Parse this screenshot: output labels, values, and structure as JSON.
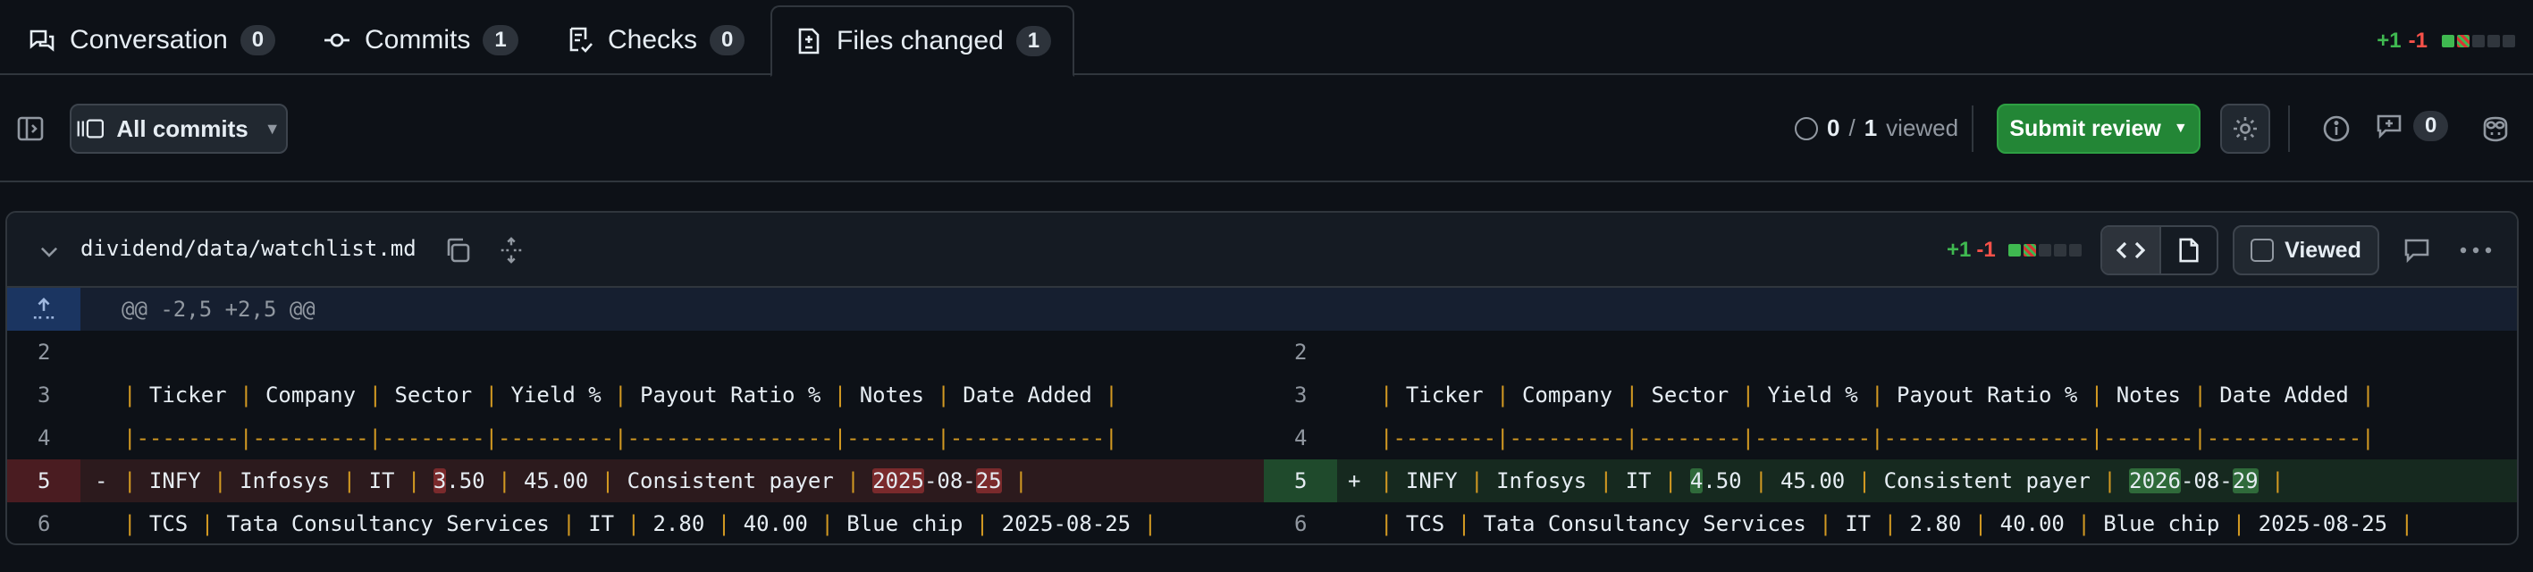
{
  "tabs": [
    {
      "label": "Conversation",
      "count": "0",
      "icon": "conversation-icon"
    },
    {
      "label": "Commits",
      "count": "1",
      "icon": "commit-icon"
    },
    {
      "label": "Checks",
      "count": "0",
      "icon": "checklist-icon"
    },
    {
      "label": "Files changed",
      "count": "1",
      "icon": "file-diff-icon"
    }
  ],
  "diffstat": {
    "additions": "+1",
    "deletions": "-1"
  },
  "toolbar": {
    "commits_label": "All commits",
    "viewed_count": "0",
    "viewed_sep": "/",
    "viewed_total": "1",
    "viewed_label": "viewed",
    "submit_label": "Submit review",
    "comments_count": "0"
  },
  "file": {
    "path": "dividend/data/watchlist.md",
    "additions": "+1",
    "deletions": "-1",
    "viewed_label": "Viewed",
    "hunk_header": "@@ -2,5 +2,5 @@"
  },
  "diff": {
    "left": [
      {
        "line": "2",
        "type": "ctx",
        "sign": "",
        "segments": []
      },
      {
        "line": "3",
        "type": "ctx",
        "sign": "",
        "segments": [
          {
            "t": "| ",
            "c": "pipe"
          },
          {
            "t": "Ticker "
          },
          {
            "t": "| ",
            "c": "pipe"
          },
          {
            "t": "Company "
          },
          {
            "t": "| ",
            "c": "pipe"
          },
          {
            "t": "Sector "
          },
          {
            "t": "| ",
            "c": "pipe"
          },
          {
            "t": "Yield % "
          },
          {
            "t": "| ",
            "c": "pipe"
          },
          {
            "t": "Payout Ratio % "
          },
          {
            "t": "| ",
            "c": "pipe"
          },
          {
            "t": "Notes "
          },
          {
            "t": "| ",
            "c": "pipe"
          },
          {
            "t": "Date Added "
          },
          {
            "t": "|",
            "c": "pipe"
          }
        ]
      },
      {
        "line": "4",
        "type": "ctx",
        "sign": "",
        "segments": [
          {
            "t": "|--------|---------|--------|---------|----------------|-------|------------|",
            "c": "pipe"
          }
        ]
      },
      {
        "line": "5",
        "type": "del",
        "sign": "-",
        "segments": [
          {
            "t": "| ",
            "c": "pipe"
          },
          {
            "t": "INFY "
          },
          {
            "t": "| ",
            "c": "pipe"
          },
          {
            "t": "Infosys "
          },
          {
            "t": "| ",
            "c": "pipe"
          },
          {
            "t": "IT "
          },
          {
            "t": "| ",
            "c": "pipe"
          },
          {
            "t": "3",
            "c": "hl-del"
          },
          {
            "t": ".50 "
          },
          {
            "t": "| ",
            "c": "pipe"
          },
          {
            "t": "45.00 "
          },
          {
            "t": "| ",
            "c": "pipe"
          },
          {
            "t": "Consistent payer "
          },
          {
            "t": "| ",
            "c": "pipe"
          },
          {
            "t": "2025",
            "c": "hl-del"
          },
          {
            "t": "-08-"
          },
          {
            "t": "25",
            "c": "hl-del"
          },
          {
            "t": " "
          },
          {
            "t": "|",
            "c": "pipe"
          }
        ]
      },
      {
        "line": "6",
        "type": "ctx",
        "sign": "",
        "segments": [
          {
            "t": "| ",
            "c": "pipe"
          },
          {
            "t": "TCS "
          },
          {
            "t": "| ",
            "c": "pipe"
          },
          {
            "t": "Tata Consultancy Services "
          },
          {
            "t": "| ",
            "c": "pipe"
          },
          {
            "t": "IT "
          },
          {
            "t": "| ",
            "c": "pipe"
          },
          {
            "t": "2.80 "
          },
          {
            "t": "| ",
            "c": "pipe"
          },
          {
            "t": "40.00 "
          },
          {
            "t": "| ",
            "c": "pipe"
          },
          {
            "t": "Blue chip "
          },
          {
            "t": "| ",
            "c": "pipe"
          },
          {
            "t": "2025-08-25 "
          },
          {
            "t": "|",
            "c": "pipe"
          }
        ]
      }
    ],
    "right": [
      {
        "line": "2",
        "type": "ctx",
        "sign": "",
        "segments": []
      },
      {
        "line": "3",
        "type": "ctx",
        "sign": "",
        "segments": [
          {
            "t": "| ",
            "c": "pipe"
          },
          {
            "t": "Ticker "
          },
          {
            "t": "| ",
            "c": "pipe"
          },
          {
            "t": "Company "
          },
          {
            "t": "| ",
            "c": "pipe"
          },
          {
            "t": "Sector "
          },
          {
            "t": "| ",
            "c": "pipe"
          },
          {
            "t": "Yield % "
          },
          {
            "t": "| ",
            "c": "pipe"
          },
          {
            "t": "Payout Ratio % "
          },
          {
            "t": "| ",
            "c": "pipe"
          },
          {
            "t": "Notes "
          },
          {
            "t": "| ",
            "c": "pipe"
          },
          {
            "t": "Date Added "
          },
          {
            "t": "|",
            "c": "pipe"
          }
        ]
      },
      {
        "line": "4",
        "type": "ctx",
        "sign": "",
        "segments": [
          {
            "t": "|--------|---------|--------|---------|----------------|-------|------------|",
            "c": "pipe"
          }
        ]
      },
      {
        "line": "5",
        "type": "add",
        "sign": "+",
        "segments": [
          {
            "t": "| ",
            "c": "pipe"
          },
          {
            "t": "INFY "
          },
          {
            "t": "| ",
            "c": "pipe"
          },
          {
            "t": "Infosys "
          },
          {
            "t": "| ",
            "c": "pipe"
          },
          {
            "t": "IT "
          },
          {
            "t": "| ",
            "c": "pipe"
          },
          {
            "t": "4",
            "c": "hl-add"
          },
          {
            "t": ".50 "
          },
          {
            "t": "| ",
            "c": "pipe"
          },
          {
            "t": "45.00 "
          },
          {
            "t": "| ",
            "c": "pipe"
          },
          {
            "t": "Consistent payer "
          },
          {
            "t": "| ",
            "c": "pipe"
          },
          {
            "t": "2026",
            "c": "hl-add"
          },
          {
            "t": "-08-"
          },
          {
            "t": "29",
            "c": "hl-add"
          },
          {
            "t": " "
          },
          {
            "t": "|",
            "c": "pipe"
          }
        ]
      },
      {
        "line": "6",
        "type": "ctx",
        "sign": "",
        "segments": [
          {
            "t": "| ",
            "c": "pipe"
          },
          {
            "t": "TCS "
          },
          {
            "t": "| ",
            "c": "pipe"
          },
          {
            "t": "Tata Consultancy Services "
          },
          {
            "t": "| ",
            "c": "pipe"
          },
          {
            "t": "IT "
          },
          {
            "t": "| ",
            "c": "pipe"
          },
          {
            "t": "2.80 "
          },
          {
            "t": "| ",
            "c": "pipe"
          },
          {
            "t": "40.00 "
          },
          {
            "t": "| ",
            "c": "pipe"
          },
          {
            "t": "Blue chip "
          },
          {
            "t": "| ",
            "c": "pipe"
          },
          {
            "t": "2025-08-25 "
          },
          {
            "t": "|",
            "c": "pipe"
          }
        ]
      }
    ]
  },
  "colors": {
    "background": "#0d1117",
    "addition": "#3fb950",
    "deletion": "#f85149",
    "submit": "#238636",
    "pipe": "#d29922"
  }
}
